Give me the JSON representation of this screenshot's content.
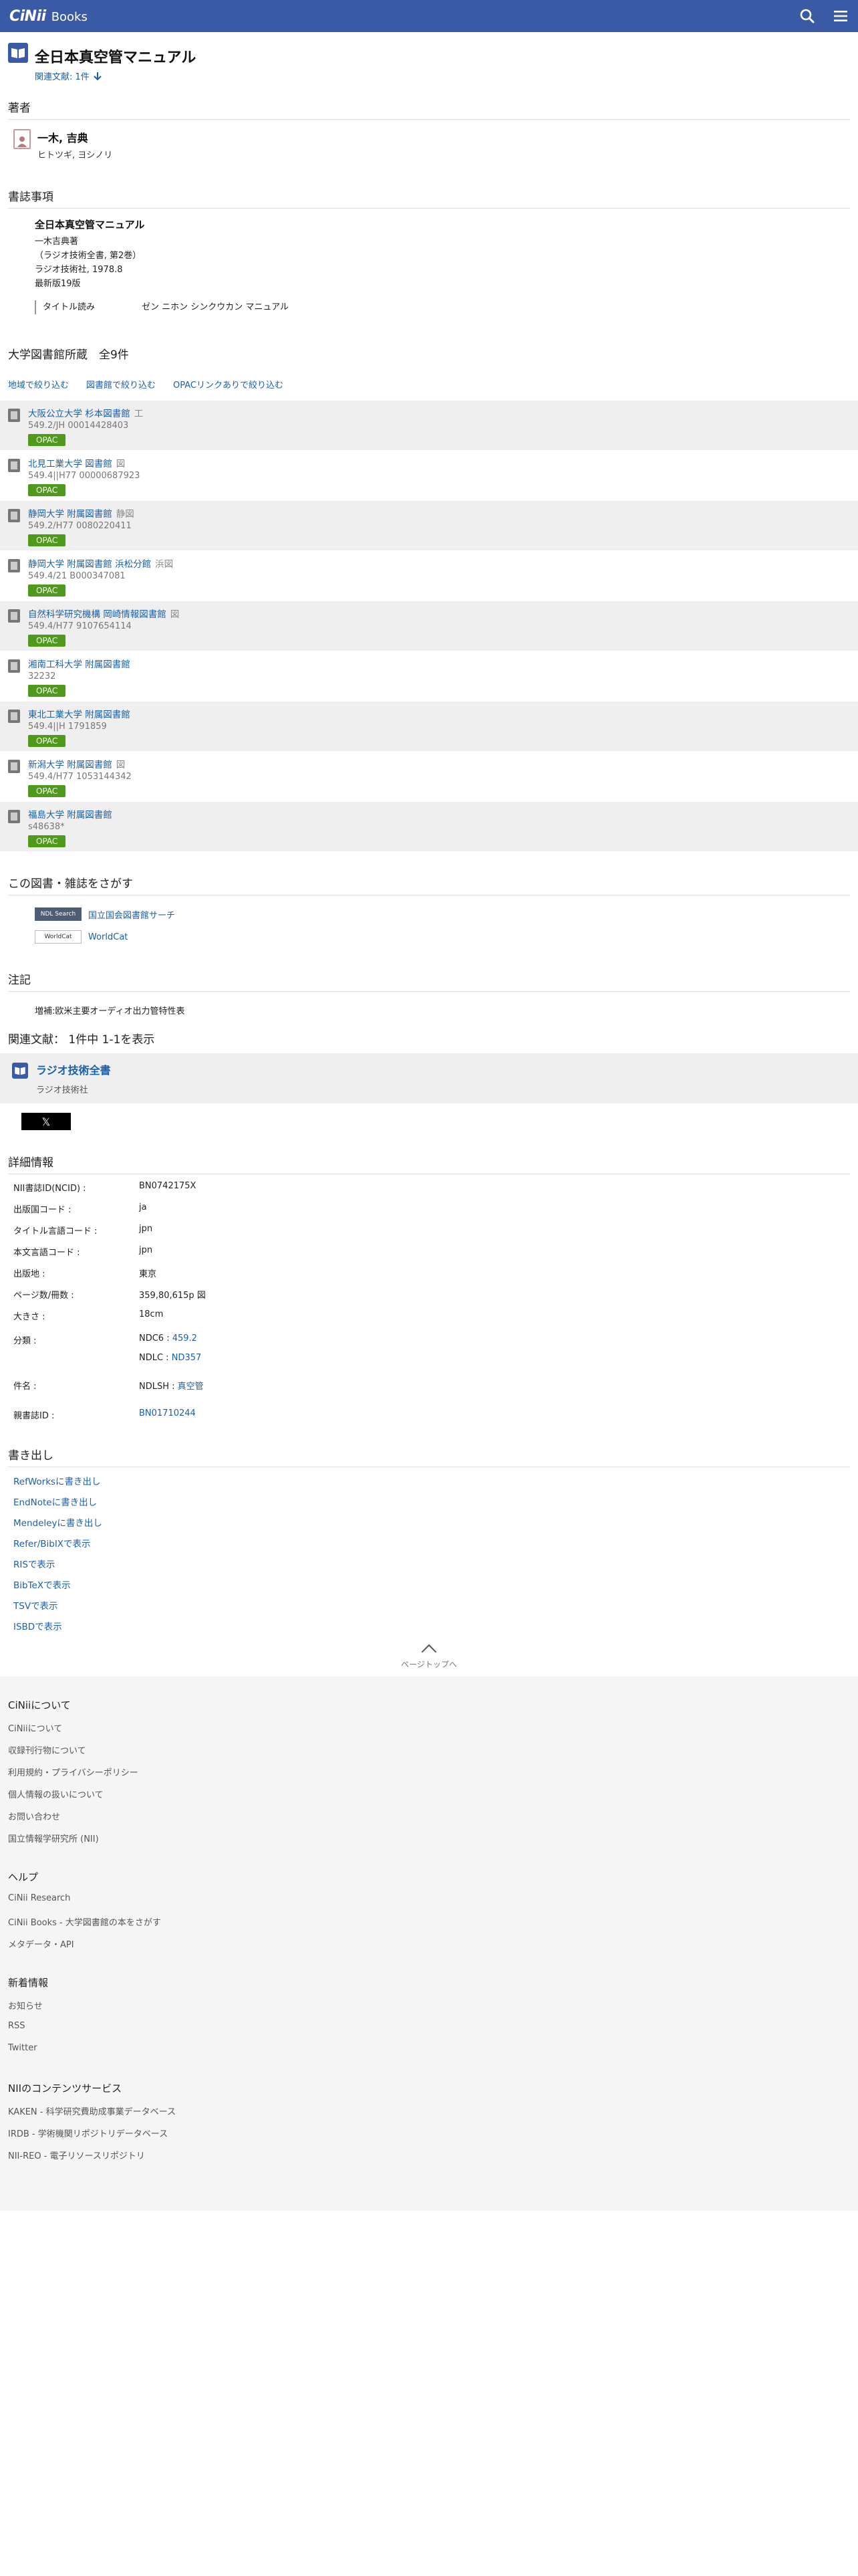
{
  "header": {
    "logo_main": "CiNii",
    "logo_sub": "Books"
  },
  "book": {
    "title": "全日本真空管マニュアル",
    "related_link": "関連文献: 1件"
  },
  "authors_section": {
    "heading": "著者",
    "name": "一木, 吉典",
    "kana": "ヒトツギ, ヨシノリ"
  },
  "biblio_section": {
    "heading": "書誌事項",
    "title": "全日本真空管マニュアル",
    "lines": [
      "一木吉典著",
      "（ラジオ技術全書, 第2巻）",
      "ラジオ技術社, 1978.8",
      "最新版19版"
    ],
    "yomi_label": "タイトル読み",
    "yomi_value": "ゼン ニホン シンクウカン マニュアル"
  },
  "holdings": {
    "heading": "大学図書館所蔵　全9件",
    "filters": [
      "地域で絞り込む",
      "図書館で絞り込む",
      "OPACリンクありで絞り込む"
    ],
    "opac_label": "OPAC",
    "libraries": [
      {
        "name": "大阪公立大学 杉本図書館",
        "suffix": "工",
        "call": "549.2/JH  00014428403",
        "opac": true
      },
      {
        "name": "北見工業大学 図書館",
        "suffix": "図",
        "call": "549.4||H77  00000687923",
        "opac": true
      },
      {
        "name": "静岡大学 附属図書館",
        "suffix": "静図",
        "call": "549.2/H77  0080220411",
        "opac": true
      },
      {
        "name": "静岡大学 附属図書館 浜松分館",
        "suffix": "浜図",
        "call": "549.4/21  B000347081",
        "opac": true
      },
      {
        "name": "自然科学研究機構 岡崎情報図書館",
        "suffix": "図",
        "call": "549.4/H77  9107654114",
        "opac": true
      },
      {
        "name": "湘南工科大学 附属図書館",
        "suffix": "",
        "call": "32232",
        "opac": true
      },
      {
        "name": "東北工業大学 附属図書館",
        "suffix": "",
        "call": "549.4||H  1791859",
        "opac": true
      },
      {
        "name": "新潟大学 附属図書館",
        "suffix": "図",
        "call": "549.4/H77  1053144342",
        "opac": true
      },
      {
        "name": "福島大学 附属図書館",
        "suffix": "",
        "call": "s48638*",
        "opac": true
      }
    ]
  },
  "search_section": {
    "heading": "この図書・雑誌をさがす",
    "links": [
      {
        "badge": "NDL Search",
        "label": "国立国会図書館サーチ"
      },
      {
        "badge": "WorldCat",
        "label": "WorldCat"
      }
    ]
  },
  "notes_section": {
    "heading": "注記",
    "text": "増補:欧米主要オーディオ出力管特性表"
  },
  "related_section": {
    "heading": "関連文献：  1件中   1-1を表示",
    "title": "ラジオ技術全書",
    "publisher": "ラジオ技術社"
  },
  "x_share": {
    "label": "𝕏"
  },
  "details_section": {
    "heading": "詳細情報",
    "rows": [
      {
        "label": "NII書誌ID(NCID)",
        "value": "BN0742175X"
      },
      {
        "label": "出版国コード",
        "value": "ja"
      },
      {
        "label": "タイトル言語コード",
        "value": "jpn"
      },
      {
        "label": "本文言語コード",
        "value": "jpn"
      },
      {
        "label": "出版地",
        "value": "東京"
      },
      {
        "label": "ページ数/冊数",
        "value": "359,80,615p 図"
      },
      {
        "label": "大きさ",
        "value": "18cm"
      }
    ],
    "class_label": "分類",
    "ndc6_prefix": "NDC6 : ",
    "ndc6_value": "459.2",
    "ndlc_prefix": "NDLC : ",
    "ndlc_value": "ND357",
    "subject_label": "件名",
    "subject_prefix": "NDLSH : ",
    "subject_value": "真空管",
    "parent_label": "親書誌ID",
    "parent_value": "BN01710244"
  },
  "export_section": {
    "heading": "書き出し",
    "links": [
      "RefWorksに書き出し",
      "EndNoteに書き出し",
      "Mendeleyに書き出し",
      "Refer/BibIXで表示",
      "RISで表示",
      "BibTeXで表示",
      "TSVで表示",
      "ISBDで表示"
    ]
  },
  "page_top": {
    "label": "ページトップへ"
  },
  "footer": {
    "groups": [
      {
        "heading": "CiNiiについて",
        "items": [
          "CiNiiについて",
          "収録刊行物について",
          "利用規約・プライバシーポリシー",
          "個人情報の扱いについて",
          "お問い合わせ",
          "国立情報学研究所 (NII)"
        ]
      },
      {
        "heading": "ヘルプ",
        "items": [
          "CiNii Research",
          "CiNii Books - 大学図書館の本をさがす",
          "メタデータ・API"
        ]
      },
      {
        "heading": "新着情報",
        "items": [
          "お知らせ",
          "RSS",
          "Twitter"
        ]
      },
      {
        "heading": "NIIのコンテンツサービス",
        "items": [
          "KAKEN - 科学研究費助成事業データベース",
          "IRDB - 学術機関リポジトリデータベース",
          "NII-REO - 電子リソースリポジトリ"
        ]
      }
    ]
  }
}
